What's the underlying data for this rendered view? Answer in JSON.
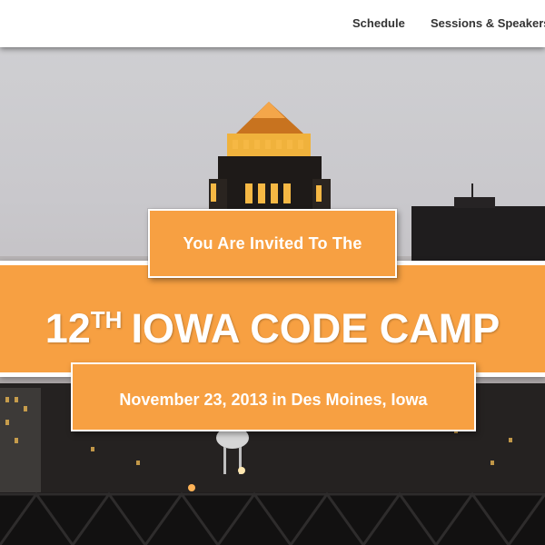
{
  "nav": {
    "items": [
      {
        "label": "Schedule"
      },
      {
        "label": "Sessions & Speakers"
      }
    ]
  },
  "hero": {
    "invite_text": "You Are Invited To The",
    "headline_number": "12",
    "headline_suffix": "TH",
    "headline_rest": "IOWA CODE CAMP",
    "date_text": "November 23, 2013 in Des Moines, Iowa",
    "background": "city-skyline-dusk-image"
  },
  "colors": {
    "accent": "#f7a042",
    "banner_text": "#ffffff",
    "nav_bg": "#ffffff",
    "nav_text": "#333333"
  }
}
